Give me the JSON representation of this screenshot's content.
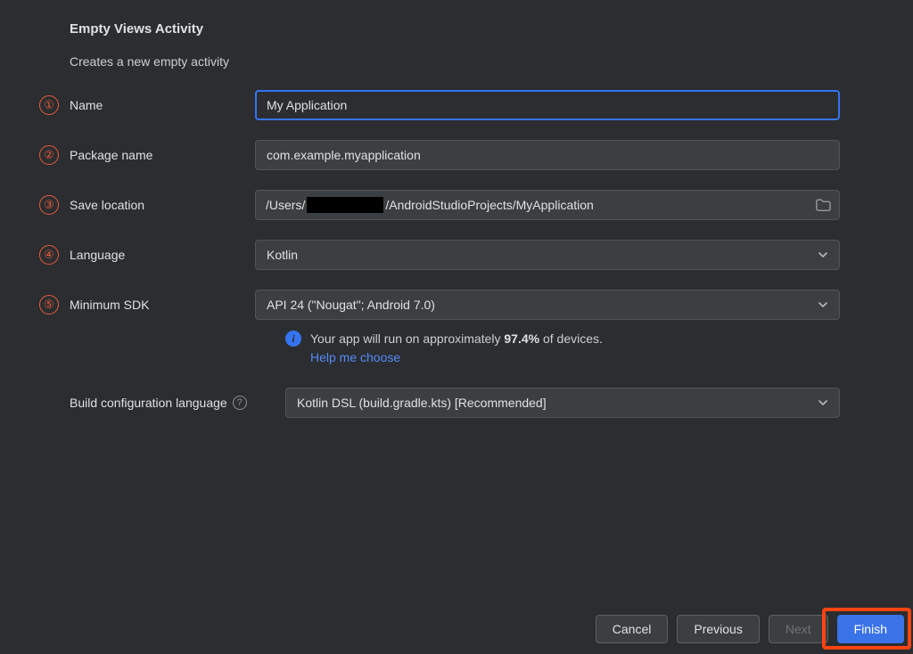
{
  "title": "Empty Views Activity",
  "description": "Creates a new empty activity",
  "annotations": {
    "a1": "①",
    "a2": "②",
    "a3": "③",
    "a4": "④",
    "a5": "⑤"
  },
  "labels": {
    "name": "Name",
    "package_name": "Package name",
    "save_location": "Save location",
    "language": "Language",
    "min_sdk": "Minimum SDK",
    "build_config": "Build configuration language"
  },
  "fields": {
    "name_value": "My Application",
    "package_value": "com.example.myapplication",
    "save_path_pre": "/Users/",
    "save_path_post": "/AndroidStudioProjects/MyApplication",
    "language_value": "Kotlin",
    "min_sdk_value": "API 24 (\"Nougat\"; Android 7.0)",
    "build_config_value": "Kotlin DSL (build.gradle.kts) [Recommended]"
  },
  "sdk_info": {
    "prefix": "Your app will run on approximately ",
    "percent": "97.4%",
    "suffix": " of devices.",
    "help_link": "Help me choose"
  },
  "buttons": {
    "cancel": "Cancel",
    "previous": "Previous",
    "next": "Next",
    "finish": "Finish"
  }
}
